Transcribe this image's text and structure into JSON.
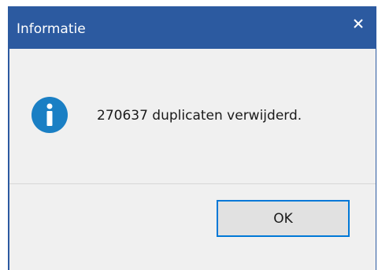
{
  "dialog": {
    "title": "Informatie",
    "close_icon": "close-icon",
    "icon": "info-icon",
    "message": "270637 duplicaten verwijderd.",
    "ok_label": "OK"
  },
  "colors": {
    "titlebar": "#2c5aa0",
    "body": "#f0f0f0",
    "info_icon": "#1a7fc4",
    "button_border": "#0078d7",
    "button_face": "#e1e1e1"
  }
}
